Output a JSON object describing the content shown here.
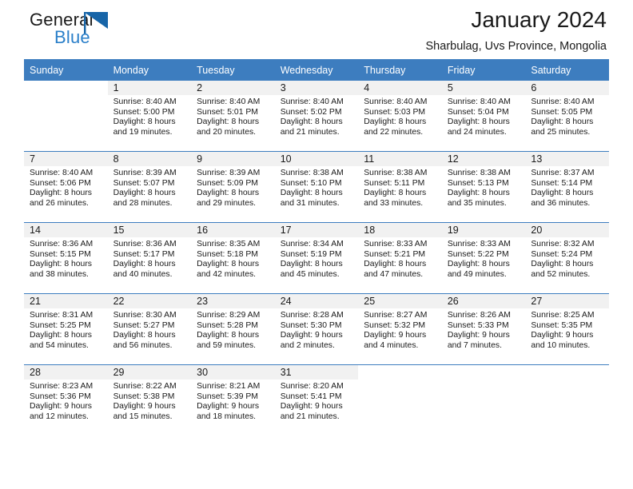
{
  "brand": {
    "name_part1": "General",
    "name_part2": "Blue",
    "accent_color": "#2a7fc9",
    "flag_icon": "triangle-flag-icon"
  },
  "header": {
    "title": "January 2024",
    "subtitle": "Sharbulag, Uvs Province, Mongolia"
  },
  "calendar": {
    "header_bg": "#3d7dbf",
    "header_text_color": "#ffffff",
    "daynum_band_bg": "#f1f1f1",
    "weekday_headers": [
      "Sunday",
      "Monday",
      "Tuesday",
      "Wednesday",
      "Thursday",
      "Friday",
      "Saturday"
    ],
    "weeks": [
      [
        {
          "day": "",
          "sunrise": "",
          "sunset": "",
          "daylight_line1": "",
          "daylight_line2": ""
        },
        {
          "day": "1",
          "sunrise": "Sunrise: 8:40 AM",
          "sunset": "Sunset: 5:00 PM",
          "daylight_line1": "Daylight: 8 hours",
          "daylight_line2": "and 19 minutes."
        },
        {
          "day": "2",
          "sunrise": "Sunrise: 8:40 AM",
          "sunset": "Sunset: 5:01 PM",
          "daylight_line1": "Daylight: 8 hours",
          "daylight_line2": "and 20 minutes."
        },
        {
          "day": "3",
          "sunrise": "Sunrise: 8:40 AM",
          "sunset": "Sunset: 5:02 PM",
          "daylight_line1": "Daylight: 8 hours",
          "daylight_line2": "and 21 minutes."
        },
        {
          "day": "4",
          "sunrise": "Sunrise: 8:40 AM",
          "sunset": "Sunset: 5:03 PM",
          "daylight_line1": "Daylight: 8 hours",
          "daylight_line2": "and 22 minutes."
        },
        {
          "day": "5",
          "sunrise": "Sunrise: 8:40 AM",
          "sunset": "Sunset: 5:04 PM",
          "daylight_line1": "Daylight: 8 hours",
          "daylight_line2": "and 24 minutes."
        },
        {
          "day": "6",
          "sunrise": "Sunrise: 8:40 AM",
          "sunset": "Sunset: 5:05 PM",
          "daylight_line1": "Daylight: 8 hours",
          "daylight_line2": "and 25 minutes."
        }
      ],
      [
        {
          "day": "7",
          "sunrise": "Sunrise: 8:40 AM",
          "sunset": "Sunset: 5:06 PM",
          "daylight_line1": "Daylight: 8 hours",
          "daylight_line2": "and 26 minutes."
        },
        {
          "day": "8",
          "sunrise": "Sunrise: 8:39 AM",
          "sunset": "Sunset: 5:07 PM",
          "daylight_line1": "Daylight: 8 hours",
          "daylight_line2": "and 28 minutes."
        },
        {
          "day": "9",
          "sunrise": "Sunrise: 8:39 AM",
          "sunset": "Sunset: 5:09 PM",
          "daylight_line1": "Daylight: 8 hours",
          "daylight_line2": "and 29 minutes."
        },
        {
          "day": "10",
          "sunrise": "Sunrise: 8:38 AM",
          "sunset": "Sunset: 5:10 PM",
          "daylight_line1": "Daylight: 8 hours",
          "daylight_line2": "and 31 minutes."
        },
        {
          "day": "11",
          "sunrise": "Sunrise: 8:38 AM",
          "sunset": "Sunset: 5:11 PM",
          "daylight_line1": "Daylight: 8 hours",
          "daylight_line2": "and 33 minutes."
        },
        {
          "day": "12",
          "sunrise": "Sunrise: 8:38 AM",
          "sunset": "Sunset: 5:13 PM",
          "daylight_line1": "Daylight: 8 hours",
          "daylight_line2": "and 35 minutes."
        },
        {
          "day": "13",
          "sunrise": "Sunrise: 8:37 AM",
          "sunset": "Sunset: 5:14 PM",
          "daylight_line1": "Daylight: 8 hours",
          "daylight_line2": "and 36 minutes."
        }
      ],
      [
        {
          "day": "14",
          "sunrise": "Sunrise: 8:36 AM",
          "sunset": "Sunset: 5:15 PM",
          "daylight_line1": "Daylight: 8 hours",
          "daylight_line2": "and 38 minutes."
        },
        {
          "day": "15",
          "sunrise": "Sunrise: 8:36 AM",
          "sunset": "Sunset: 5:17 PM",
          "daylight_line1": "Daylight: 8 hours",
          "daylight_line2": "and 40 minutes."
        },
        {
          "day": "16",
          "sunrise": "Sunrise: 8:35 AM",
          "sunset": "Sunset: 5:18 PM",
          "daylight_line1": "Daylight: 8 hours",
          "daylight_line2": "and 42 minutes."
        },
        {
          "day": "17",
          "sunrise": "Sunrise: 8:34 AM",
          "sunset": "Sunset: 5:19 PM",
          "daylight_line1": "Daylight: 8 hours",
          "daylight_line2": "and 45 minutes."
        },
        {
          "day": "18",
          "sunrise": "Sunrise: 8:33 AM",
          "sunset": "Sunset: 5:21 PM",
          "daylight_line1": "Daylight: 8 hours",
          "daylight_line2": "and 47 minutes."
        },
        {
          "day": "19",
          "sunrise": "Sunrise: 8:33 AM",
          "sunset": "Sunset: 5:22 PM",
          "daylight_line1": "Daylight: 8 hours",
          "daylight_line2": "and 49 minutes."
        },
        {
          "day": "20",
          "sunrise": "Sunrise: 8:32 AM",
          "sunset": "Sunset: 5:24 PM",
          "daylight_line1": "Daylight: 8 hours",
          "daylight_line2": "and 52 minutes."
        }
      ],
      [
        {
          "day": "21",
          "sunrise": "Sunrise: 8:31 AM",
          "sunset": "Sunset: 5:25 PM",
          "daylight_line1": "Daylight: 8 hours",
          "daylight_line2": "and 54 minutes."
        },
        {
          "day": "22",
          "sunrise": "Sunrise: 8:30 AM",
          "sunset": "Sunset: 5:27 PM",
          "daylight_line1": "Daylight: 8 hours",
          "daylight_line2": "and 56 minutes."
        },
        {
          "day": "23",
          "sunrise": "Sunrise: 8:29 AM",
          "sunset": "Sunset: 5:28 PM",
          "daylight_line1": "Daylight: 8 hours",
          "daylight_line2": "and 59 minutes."
        },
        {
          "day": "24",
          "sunrise": "Sunrise: 8:28 AM",
          "sunset": "Sunset: 5:30 PM",
          "daylight_line1": "Daylight: 9 hours",
          "daylight_line2": "and 2 minutes."
        },
        {
          "day": "25",
          "sunrise": "Sunrise: 8:27 AM",
          "sunset": "Sunset: 5:32 PM",
          "daylight_line1": "Daylight: 9 hours",
          "daylight_line2": "and 4 minutes."
        },
        {
          "day": "26",
          "sunrise": "Sunrise: 8:26 AM",
          "sunset": "Sunset: 5:33 PM",
          "daylight_line1": "Daylight: 9 hours",
          "daylight_line2": "and 7 minutes."
        },
        {
          "day": "27",
          "sunrise": "Sunrise: 8:25 AM",
          "sunset": "Sunset: 5:35 PM",
          "daylight_line1": "Daylight: 9 hours",
          "daylight_line2": "and 10 minutes."
        }
      ],
      [
        {
          "day": "28",
          "sunrise": "Sunrise: 8:23 AM",
          "sunset": "Sunset: 5:36 PM",
          "daylight_line1": "Daylight: 9 hours",
          "daylight_line2": "and 12 minutes."
        },
        {
          "day": "29",
          "sunrise": "Sunrise: 8:22 AM",
          "sunset": "Sunset: 5:38 PM",
          "daylight_line1": "Daylight: 9 hours",
          "daylight_line2": "and 15 minutes."
        },
        {
          "day": "30",
          "sunrise": "Sunrise: 8:21 AM",
          "sunset": "Sunset: 5:39 PM",
          "daylight_line1": "Daylight: 9 hours",
          "daylight_line2": "and 18 minutes."
        },
        {
          "day": "31",
          "sunrise": "Sunrise: 8:20 AM",
          "sunset": "Sunset: 5:41 PM",
          "daylight_line1": "Daylight: 9 hours",
          "daylight_line2": "and 21 minutes."
        },
        {
          "day": "",
          "sunrise": "",
          "sunset": "",
          "daylight_line1": "",
          "daylight_line2": ""
        },
        {
          "day": "",
          "sunrise": "",
          "sunset": "",
          "daylight_line1": "",
          "daylight_line2": ""
        },
        {
          "day": "",
          "sunrise": "",
          "sunset": "",
          "daylight_line1": "",
          "daylight_line2": ""
        }
      ]
    ]
  }
}
